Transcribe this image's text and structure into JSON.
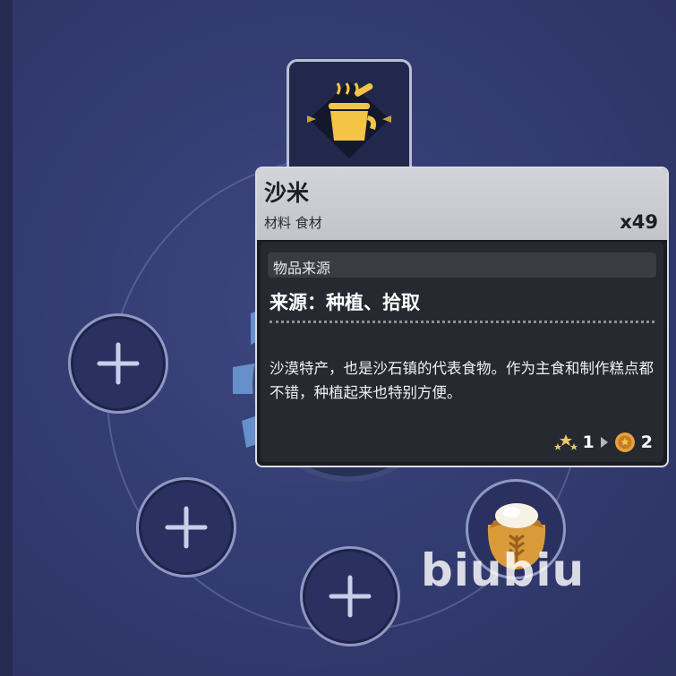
{
  "item": {
    "name": "沙米",
    "tags": "材料 食材",
    "count": "x49",
    "source_section_label": "物品来源",
    "source_value": "来源：种植、拾取",
    "description": "沙漠特产，也是沙石镇的代表食物。作为主食和制作糕点都不错，种植起来也特别方便。",
    "stars": "1",
    "coins": "2"
  },
  "watermark": "biubiu",
  "icons": {
    "pot": "cooking-pot-icon",
    "add": "plus-icon",
    "flour": "flour-sack-icon",
    "stars": "stars-icon",
    "coin": "coin-icon",
    "arrow": "arrow-right-icon"
  },
  "colors": {
    "background": "#343d72",
    "gold": "#f4c445",
    "tooltip_header": "#c8cad0"
  }
}
